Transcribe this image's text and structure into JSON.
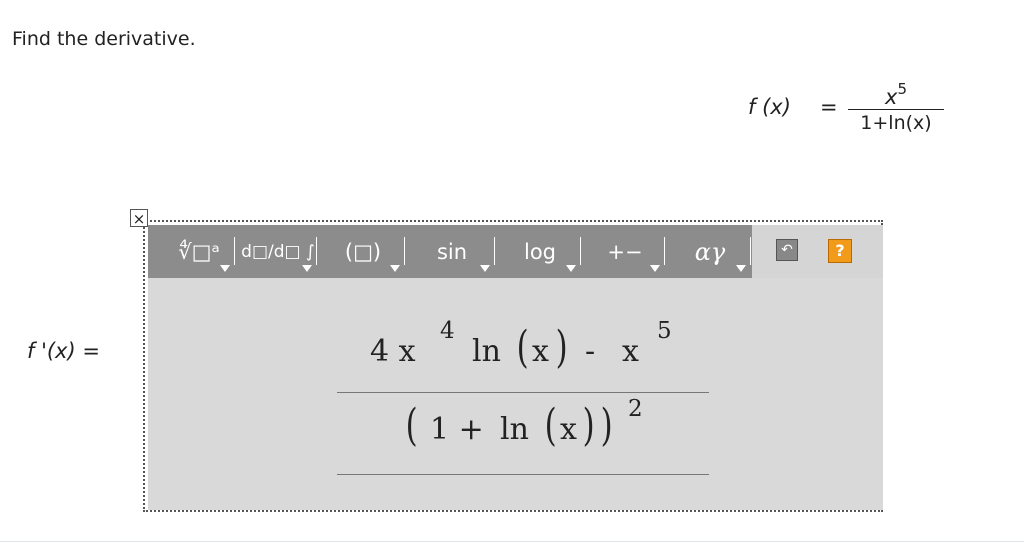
{
  "prompt": "Find the derivative.",
  "given": {
    "lhs": "f (x)",
    "eq": "=",
    "numerator": "x",
    "numerator_exp": "5",
    "denominator": "1+ln(x)"
  },
  "answer_label": "f '(x) =",
  "editor": {
    "close_icon": "×",
    "toolbar": {
      "buttons": [
        "∜□ᵃ",
        "d□/d□ ∫",
        "(□)",
        "sin",
        "log",
        "+−",
        "αγ"
      ],
      "undo_icon": "↶",
      "help_icon": "?"
    },
    "answer": {
      "numerator": {
        "coef": "4 x",
        "coef_exp": "4",
        "ln": "ln",
        "arg": "x",
        "minus": "-",
        "x": "x",
        "x_exp": "5"
      },
      "denominator": {
        "one_plus": "1 +",
        "ln": "ln",
        "arg": "x",
        "exp": "2"
      }
    }
  },
  "colors": {
    "toolbar_gray": "#8c8c8c",
    "edit_area": "#d9d9d9",
    "help_orange": "#f29a1a"
  }
}
